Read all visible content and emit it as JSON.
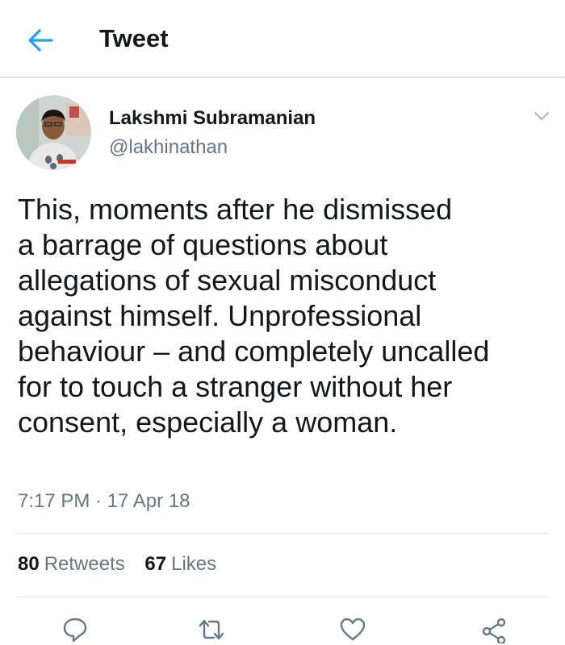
{
  "header": {
    "title": "Tweet",
    "back_icon": "arrow-left-icon",
    "accent_color": "#1da1f2"
  },
  "tweet": {
    "author": {
      "display_name": "Lakshmi Subramanian",
      "handle": "@lakhinathan"
    },
    "text_lines": [
      "This, moments after he dismissed",
      "a barrage of questions about",
      "allegations of sexual misconduct",
      "against himself. Unprofessional",
      "behaviour – and completely uncalled",
      "for to touch a stranger without her",
      "consent, especially a woman."
    ],
    "timestamp": "7:17 PM · 17 Apr 18",
    "stats": {
      "retweets_count": "80",
      "retweets_label": "Retweets",
      "likes_count": "67",
      "likes_label": "Likes"
    }
  },
  "actions": [
    "reply-icon",
    "retweet-icon",
    "like-icon",
    "share-icon"
  ],
  "colors": {
    "text_primary": "#14171a",
    "text_secondary": "#657786",
    "divider": "#e1e8ed"
  }
}
